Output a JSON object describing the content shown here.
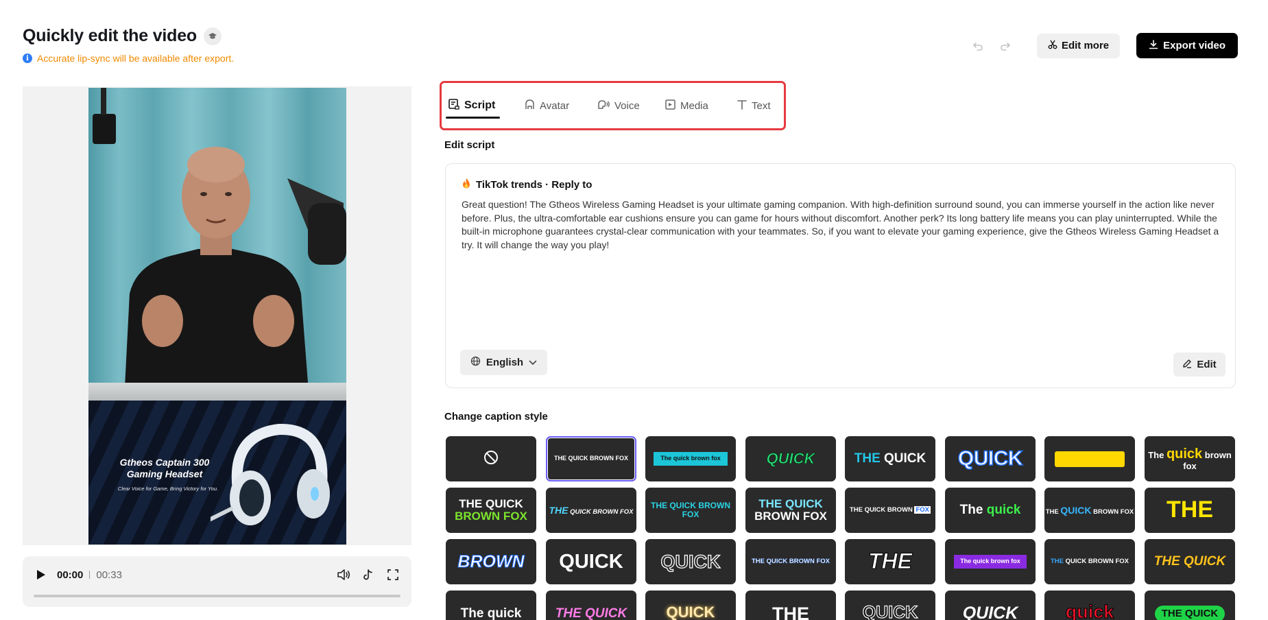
{
  "header": {
    "title": "Quickly edit the video",
    "notice": "Accurate lip-sync will be available after export."
  },
  "toolbar": {
    "edit_more_label": "Edit more",
    "export_label": "Export video"
  },
  "preview": {
    "product_name": "Gtheos Captain 300 Gaming Headset",
    "product_tagline": "Clear Voice for Game, Bring Victory for You."
  },
  "player": {
    "current_time": "00:00",
    "duration": "00:33",
    "progress": 0
  },
  "tabs": [
    {
      "label": "Script",
      "icon": "script-icon",
      "active": true
    },
    {
      "label": "Avatar",
      "icon": "avatar-icon",
      "active": false
    },
    {
      "label": "Voice",
      "icon": "voice-icon",
      "active": false
    },
    {
      "label": "Media",
      "icon": "media-icon",
      "active": false
    },
    {
      "label": "Text",
      "icon": "text-icon",
      "active": false
    }
  ],
  "script": {
    "section_label": "Edit script",
    "source": "TikTok trends · Reply to",
    "text": "Great question! The Gtheos Wireless Gaming Headset is your ultimate gaming companion. With high-definition surround sound, you can immerse yourself in the action like never before. Plus, the ultra-comfortable ear cushions ensure you can game for hours without discomfort. Another perk? Its long battery life means you can play uninterrupted. While the built-in microphone guarantees crystal-clear communication with your teammates. So, if you want to elevate your gaming experience, give the Gtheos Wireless Gaming Headset a try. It will change the way you play!",
    "language": "English",
    "edit_label": "Edit"
  },
  "captions": {
    "section_label": "Change caption style",
    "styles": [
      {
        "label": ""
      },
      {
        "label": "THE QUICK BROWN FOX"
      },
      {
        "label": "The quick brown fox"
      },
      {
        "label": "QUICK"
      },
      {
        "label": "THE QUICK"
      },
      {
        "label": "QUICK"
      },
      {
        "label": ""
      },
      {
        "label": "The quick brown fox"
      },
      {
        "label": "THE QUICK BROWN FOX"
      },
      {
        "label": "THE QUICK BROWN FOX"
      },
      {
        "label": "THE QUICK BROWN FOX"
      },
      {
        "label": "THE QUICK BROWN FOX"
      },
      {
        "label": "THE QUICK BROWN FOX"
      },
      {
        "label": "The quick"
      },
      {
        "label": "THE QUICK BROWN FOX"
      },
      {
        "label": "THE"
      },
      {
        "label": "BROWN"
      },
      {
        "label": "QUICK"
      },
      {
        "label": "QUICK"
      },
      {
        "label": "THE QUICK BROWN FOX"
      },
      {
        "label": "THE"
      },
      {
        "label": "The quick brown fox"
      },
      {
        "label": "THE QUICK BROWN FOX"
      },
      {
        "label": "THE QUICK"
      },
      {
        "label": "The quick"
      },
      {
        "label": "THE QUICK"
      },
      {
        "label": "QUICK"
      },
      {
        "label": "THE"
      },
      {
        "label": "QUICK"
      },
      {
        "label": "QUICK"
      },
      {
        "label": "quick"
      },
      {
        "label": "THE QUICK"
      }
    ]
  },
  "colors": {
    "accent_red": "#e6393f",
    "notice_orange": "#f08a00",
    "selection_purple": "#6a5cf3"
  }
}
